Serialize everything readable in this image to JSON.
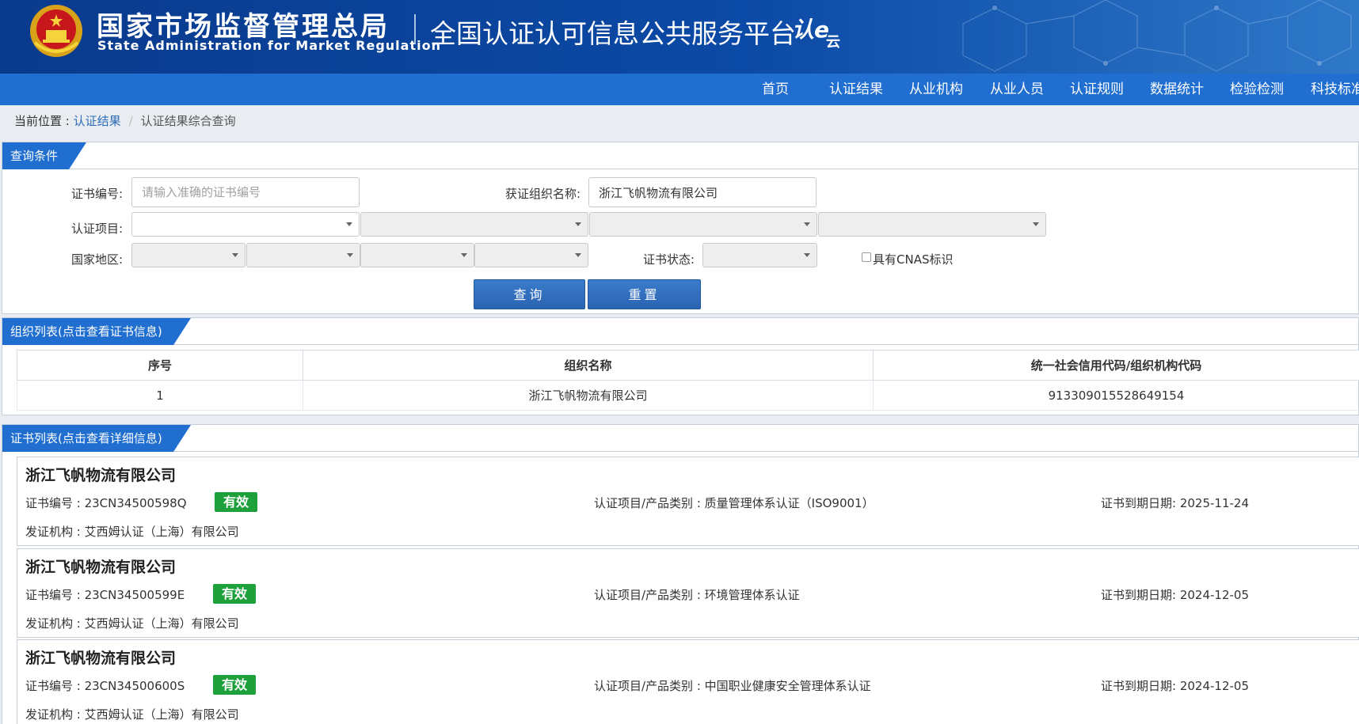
{
  "header": {
    "org_cn": "国家市场监督管理总局",
    "org_en": "State Administration  for  Market Regulation",
    "platform": "全国认证认可信息公共服务平台",
    "brand_main": "认e",
    "brand_sub": "云",
    "colors": {
      "banner": "#0b4aa6",
      "nav": "#1f6ed0"
    }
  },
  "nav": {
    "items": [
      "首页",
      "认证结果",
      "从业机构",
      "从业人员",
      "认证规则",
      "数据统计",
      "检验检测",
      "科技标准"
    ]
  },
  "breadcrumb": {
    "label": "当前位置 : ",
    "link": "认证结果",
    "separator": "/",
    "current": "认证结果综合查询"
  },
  "query": {
    "title": "查询条件",
    "cert_no_label": "证书编号:",
    "cert_no_placeholder": "请输入准确的证书编号",
    "org_name_label": "获证组织名称:",
    "org_name_value": "浙江飞帆物流有限公司",
    "project_label": "认证项目:",
    "region_label": "国家地区:",
    "status_label": "证书状态:",
    "cnas_label": "具有CNAS标识",
    "query_button": "查询",
    "reset_button": "重置"
  },
  "org_list": {
    "title": "组织列表(点击查看证书信息)",
    "columns": [
      "序号",
      "组织名称",
      "统一社会信用代码/组织机构代码"
    ],
    "rows": [
      [
        "1",
        "浙江飞帆物流有限公司",
        "913309015528649154"
      ]
    ]
  },
  "cert_list": {
    "title": "证书列表(点击查看详细信息)",
    "labels": {
      "cert_no": "证书编号 : ",
      "project": "认证项目/产品类别 : ",
      "expiry": "证书到期日期: ",
      "issuer": "发证机构 : "
    },
    "items": [
      {
        "org": "浙江飞帆物流有限公司",
        "cert_no": "23CN34500598Q",
        "status": "有效",
        "project": "质量管理体系认证（ISO9001）",
        "expiry": "2025-11-24",
        "issuer": "艾西姆认证（上海）有限公司"
      },
      {
        "org": "浙江飞帆物流有限公司",
        "cert_no": "23CN34500599E",
        "status": "有效",
        "project": "环境管理体系认证",
        "expiry": "2024-12-05",
        "issuer": "艾西姆认证（上海）有限公司"
      },
      {
        "org": "浙江飞帆物流有限公司",
        "cert_no": "23CN34500600S",
        "status": "有效",
        "project": "中国职业健康安全管理体系认证",
        "expiry": "2024-12-05",
        "issuer": "艾西姆认证（上海）有限公司"
      }
    ]
  }
}
